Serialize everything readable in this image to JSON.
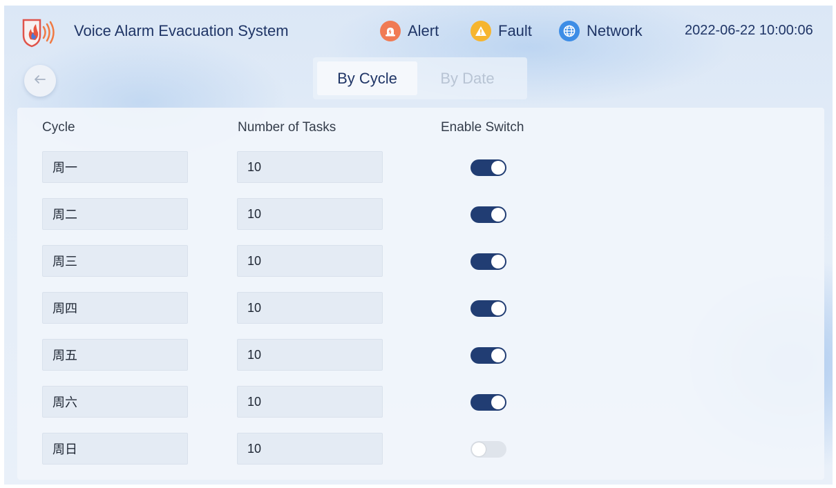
{
  "header": {
    "title": "Voice Alarm Evacuation System",
    "logo_icon": "fire-speaker-logo-icon",
    "status": {
      "alert": {
        "label": "Alert",
        "icon": "siren-icon",
        "color": "#f07b54"
      },
      "fault": {
        "label": "Fault",
        "icon": "warning-icon",
        "color": "#f6b52f"
      },
      "network": {
        "label": "Network",
        "icon": "globe-icon",
        "color": "#3d8de6"
      }
    },
    "datetime": "2022-06-22 10:00:06"
  },
  "nav": {
    "back_icon": "arrow-left-icon",
    "tabs": [
      {
        "label": "By Cycle",
        "active": true
      },
      {
        "label": "By Date",
        "active": false
      }
    ]
  },
  "table": {
    "columns": [
      "Cycle",
      "Number of Tasks",
      "Enable Switch"
    ],
    "rows": [
      {
        "cycle": "周一",
        "tasks": "10",
        "enabled": true
      },
      {
        "cycle": "周二",
        "tasks": "10",
        "enabled": true
      },
      {
        "cycle": "周三",
        "tasks": "10",
        "enabled": true
      },
      {
        "cycle": "周四",
        "tasks": "10",
        "enabled": true
      },
      {
        "cycle": "周五",
        "tasks": "10",
        "enabled": true
      },
      {
        "cycle": "周六",
        "tasks": "10",
        "enabled": true
      },
      {
        "cycle": "周日",
        "tasks": "10",
        "enabled": false
      }
    ]
  },
  "colors": {
    "toggle_on": "#213d73",
    "toggle_off": "#dfe4eb",
    "text_primary": "#1f3566"
  }
}
